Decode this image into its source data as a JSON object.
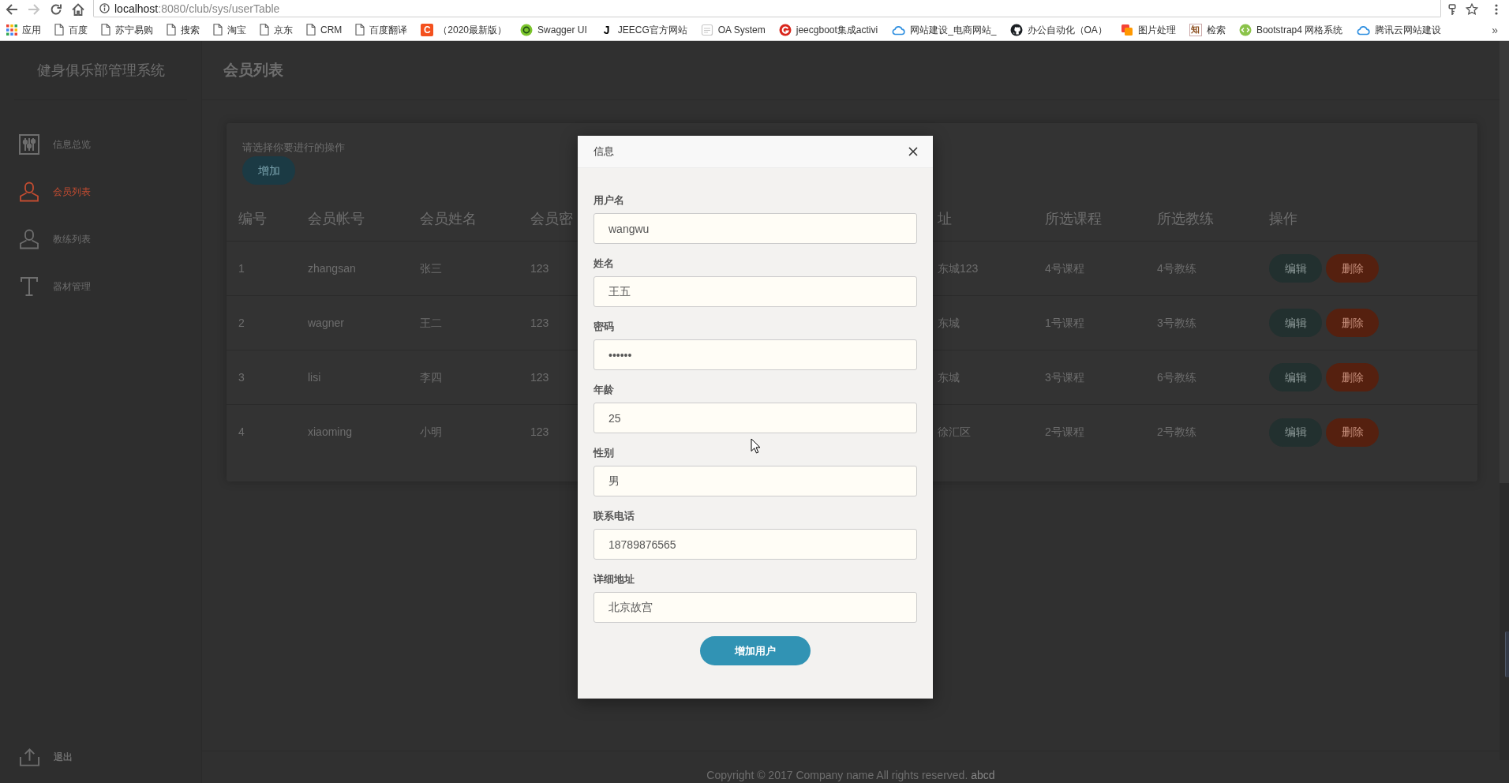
{
  "browser": {
    "back": {
      "disabled": false
    },
    "forward": {
      "disabled": true
    },
    "url": {
      "host": "localhost",
      "path": ":8080/club/sys/userTable"
    },
    "bookmarks": [
      {
        "kind": "apps",
        "label": "应用"
      },
      {
        "kind": "page",
        "label": "百度"
      },
      {
        "kind": "page",
        "label": "苏宁易购"
      },
      {
        "kind": "page",
        "label": "搜索"
      },
      {
        "kind": "page",
        "label": "淘宝"
      },
      {
        "kind": "page",
        "label": "京东"
      },
      {
        "kind": "page",
        "label": "CRM"
      },
      {
        "kind": "page",
        "label": "百度翻译"
      },
      {
        "kind": "letter",
        "glyph": "C",
        "label": "（2020最新版）"
      },
      {
        "kind": "site",
        "label": "Swagger UI"
      },
      {
        "kind": "letter",
        "glyph": "J",
        "label": "JEECG官方网站"
      },
      {
        "kind": "site",
        "label": "OA System"
      },
      {
        "kind": "site",
        "label": "jeecgboot集成activi"
      },
      {
        "kind": "site",
        "label": "网站建设_电商网站_"
      },
      {
        "kind": "site",
        "label": "办公自动化（OA）"
      },
      {
        "kind": "site",
        "label": "图片处理"
      },
      {
        "kind": "letter",
        "glyph": "知",
        "label": "检索"
      },
      {
        "kind": "site",
        "label": "Bootstrap4 网格系统"
      },
      {
        "kind": "site",
        "label": "腾讯云网站建设"
      }
    ],
    "overflow": "»"
  },
  "sidebar": {
    "title": "健身俱乐部管理系统",
    "items": [
      {
        "label": "信息总览",
        "selected": false
      },
      {
        "label": "会员列表",
        "selected": true
      },
      {
        "label": "教练列表",
        "selected": false
      },
      {
        "label": "器材管理",
        "selected": false
      }
    ],
    "logout": "退出"
  },
  "page": {
    "title": "会员列表"
  },
  "card": {
    "prompt": "请选择你要进行的操作",
    "add_button": "增加"
  },
  "table": {
    "columns": [
      "编号",
      "会员帐号",
      "会员姓名",
      "会员密",
      "址",
      "所选课程",
      "所选教练",
      "操作"
    ],
    "rows": [
      {
        "cells": [
          "1",
          "zhangsan",
          "张三",
          "123",
          "东城123",
          "4号课程",
          "4号教练"
        ],
        "actions": [
          {
            "kind": "edit",
            "label": "编辑"
          },
          {
            "kind": "delete",
            "label": "删除"
          }
        ]
      },
      {
        "cells": [
          "2",
          "wagner",
          "王二",
          "123",
          "东城",
          "1号课程",
          "3号教练"
        ],
        "actions": [
          {
            "kind": "edit",
            "label": "编辑"
          },
          {
            "kind": "delete",
            "label": "删除"
          }
        ]
      },
      {
        "cells": [
          "3",
          "lisi",
          "李四",
          "123",
          "东城",
          "3号课程",
          "6号教练"
        ],
        "actions": [
          {
            "kind": "edit",
            "label": "编辑"
          },
          {
            "kind": "delete",
            "label": "删除"
          }
        ]
      },
      {
        "cells": [
          "4",
          "xiaoming",
          "小明",
          "123",
          "徐汇区",
          "2号课程",
          "2号教练"
        ],
        "actions": [
          {
            "kind": "edit",
            "label": "编辑"
          },
          {
            "kind": "delete",
            "label": "删除"
          }
        ]
      }
    ]
  },
  "modal": {
    "title": "信息",
    "fields": [
      {
        "label": "用户名",
        "value": "wangwu"
      },
      {
        "label": "姓名",
        "value": "王五"
      },
      {
        "label": "密码",
        "value": "••••••"
      },
      {
        "label": "年龄",
        "value": "25"
      },
      {
        "label": "性别",
        "value": "男"
      },
      {
        "label": "联系电话",
        "value": "18789876565"
      },
      {
        "label": "详细地址",
        "value": "北京故宫"
      }
    ],
    "submit": "增加用户"
  },
  "footer": {
    "copyright": "Copyright © 2017 Company name All rights reserved.",
    "link": "abcd"
  }
}
